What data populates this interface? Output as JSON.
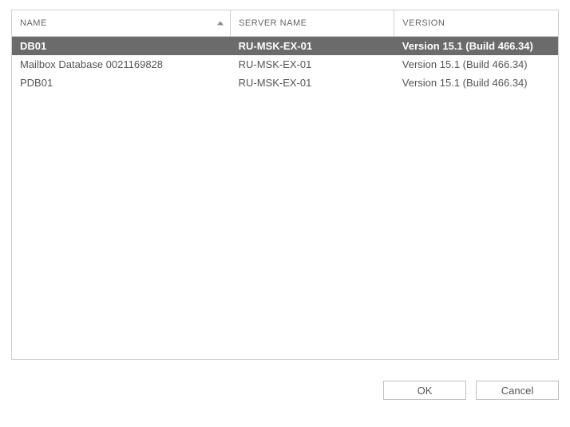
{
  "columns": {
    "name": "NAME",
    "server": "SERVER NAME",
    "version": "VERSION"
  },
  "rows": [
    {
      "name": "DB01",
      "server": "RU-MSK-EX-01",
      "version": "Version 15.1 (Build 466.34)",
      "selected": true
    },
    {
      "name": "Mailbox Database 0021169828",
      "server": "RU-MSK-EX-01",
      "version": "Version 15.1 (Build 466.34)",
      "selected": false
    },
    {
      "name": "PDB01",
      "server": "RU-MSK-EX-01",
      "version": "Version 15.1 (Build 466.34)",
      "selected": false
    }
  ],
  "buttons": {
    "ok": "OK",
    "cancel": "Cancel"
  }
}
